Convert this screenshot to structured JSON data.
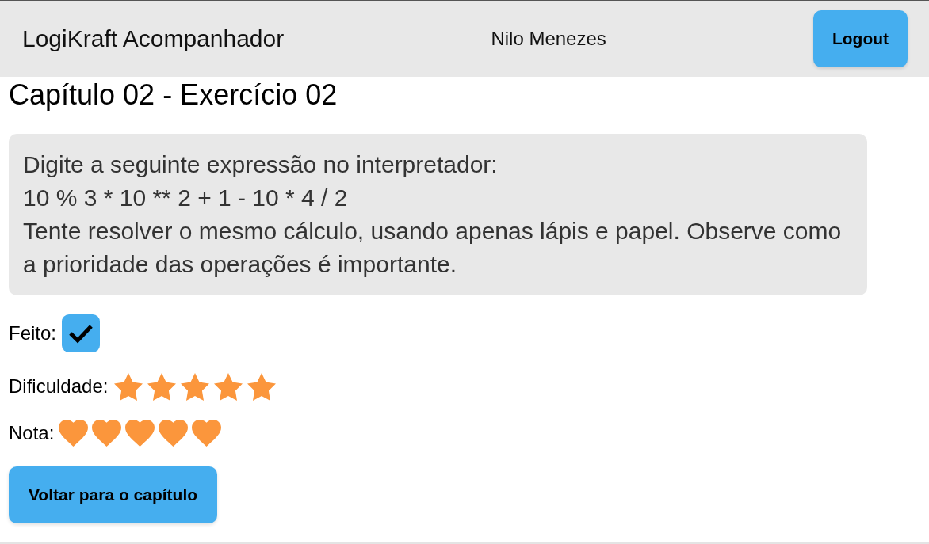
{
  "header": {
    "app_title": "LogiKraft Acompanhador",
    "user_name": "Nilo Menezes",
    "logout_button": "Logout"
  },
  "page": {
    "title": "Capítulo 02 - Exercício 02",
    "instructions": [
      "Digite a seguinte expressão no interpretador:",
      "10 % 3 * 10 ** 2 + 1 - 10 * 4 / 2",
      "Tente resolver o mesmo cálculo, usando apenas lápis e papel. Observe como a prioridade das operações é importante."
    ],
    "done": {
      "label": "Feito:",
      "checked": true
    },
    "difficulty": {
      "label": "Dificuldade:",
      "stars": 5
    },
    "grade": {
      "label": "Nota:",
      "stars": 5
    },
    "back_button": "Voltar para o capítulo"
  }
}
